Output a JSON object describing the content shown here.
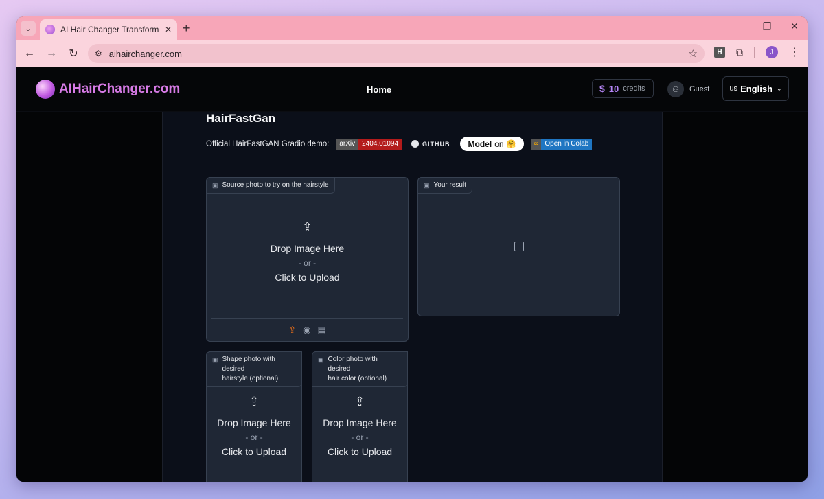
{
  "browser": {
    "tab_title": "AI Hair Changer Transform Your",
    "url": "aihairchanger.com",
    "profile_initial": "J",
    "extension_label": "H"
  },
  "header": {
    "logo_text": "AIHairChanger.com",
    "nav_home": "Home",
    "credits_symbol": "$",
    "credits_count": "10",
    "credits_label": "credits",
    "guest_label": "Guest",
    "lang_flag": "us",
    "lang_name": "English"
  },
  "app": {
    "title": "HairFastGan",
    "demo_text": "Official HairFastGAN Gradio demo:",
    "badge_arxiv_left": "arXiv",
    "badge_arxiv_right": "2404.01094",
    "badge_github": "GITHUB",
    "badge_model_left": "Model",
    "badge_model_right": "on",
    "badge_colab_right": "Open in Colab"
  },
  "panels": {
    "source": {
      "label": "Source photo to try on the hairstyle",
      "drop_main": "Drop Image Here",
      "drop_or": "- or -",
      "drop_click": "Click to Upload"
    },
    "result": {
      "label": "Your result"
    },
    "shape": {
      "label_line1": "Shape photo with desired",
      "label_line2": "hairstyle (optional)",
      "drop_main": "Drop Image Here",
      "drop_or": "- or -",
      "drop_click": "Click to Upload"
    },
    "color": {
      "label_line1": "Color photo with desired",
      "label_line2": "hair color (optional)",
      "drop_main": "Drop Image Here",
      "drop_or": "- or -",
      "drop_click": "Click to Upload"
    }
  },
  "colors": {
    "accent_purple": "#b484f5",
    "upload_active": "#f97316",
    "panel_bg": "#1f2735"
  }
}
